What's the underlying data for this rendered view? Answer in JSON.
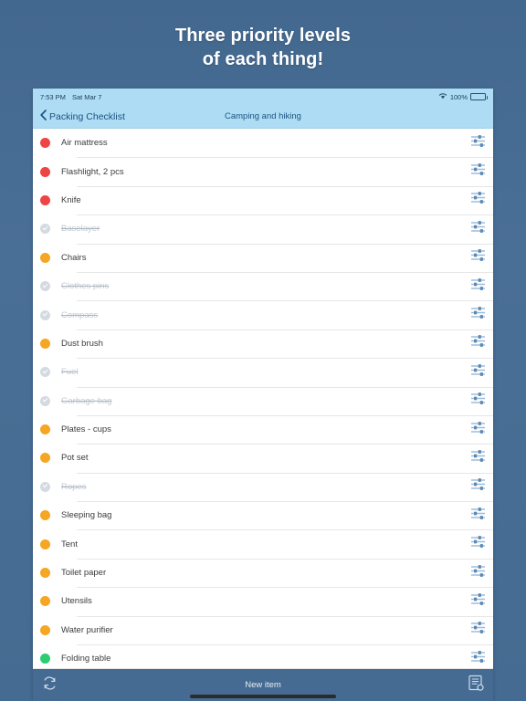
{
  "promo": {
    "line1": "Three priority levels",
    "line2": "of each thing!"
  },
  "colors": {
    "background": "#456b92",
    "navbar": "#addcf4",
    "nav_text": "#1c5480",
    "toolbar": "#456b92",
    "priority_high": "#ee4444",
    "priority_medium": "#f5a623",
    "priority_low": "#2ecc71",
    "completed": "#d4dae0",
    "slider_icon": "#5b88b5"
  },
  "statusbar": {
    "time": "7:53 PM",
    "date": "Sat Mar 7",
    "wifi_icon": "wifi-icon",
    "battery_percent": "100%",
    "battery_icon": "battery-icon"
  },
  "navbar": {
    "back_icon": "chevron-left-icon",
    "back_label": "Packing Checklist",
    "title": "Camping and hiking"
  },
  "list": {
    "row_action_icon": "sliders-icon",
    "items": [
      {
        "label": "Air mattress",
        "priority": "high",
        "completed": false
      },
      {
        "label": "Flashlight, 2 pcs",
        "priority": "high",
        "completed": false
      },
      {
        "label": "Knife",
        "priority": "high",
        "completed": false
      },
      {
        "label": "Baselayer",
        "priority": "completed",
        "completed": true
      },
      {
        "label": "Chairs",
        "priority": "medium",
        "completed": false
      },
      {
        "label": "Clothes pins",
        "priority": "completed",
        "completed": true
      },
      {
        "label": "Compass",
        "priority": "completed",
        "completed": true
      },
      {
        "label": "Dust brush",
        "priority": "medium",
        "completed": false
      },
      {
        "label": "Fuel",
        "priority": "completed",
        "completed": true
      },
      {
        "label": "Garbage bag",
        "priority": "completed",
        "completed": true
      },
      {
        "label": "Plates - cups",
        "priority": "medium",
        "completed": false
      },
      {
        "label": "Pot set",
        "priority": "medium",
        "completed": false
      },
      {
        "label": "Ropes",
        "priority": "completed",
        "completed": true
      },
      {
        "label": "Sleeping bag",
        "priority": "medium",
        "completed": false
      },
      {
        "label": "Tent",
        "priority": "medium",
        "completed": false
      },
      {
        "label": "Toilet paper",
        "priority": "medium",
        "completed": false
      },
      {
        "label": "Utensils",
        "priority": "medium",
        "completed": false
      },
      {
        "label": "Water purifier",
        "priority": "medium",
        "completed": false
      },
      {
        "label": "Folding table",
        "priority": "low",
        "completed": false
      }
    ]
  },
  "toolbar": {
    "refresh_icon": "sync-refresh-icon",
    "new_item_label": "New item",
    "lists_icon": "document-add-icon"
  }
}
